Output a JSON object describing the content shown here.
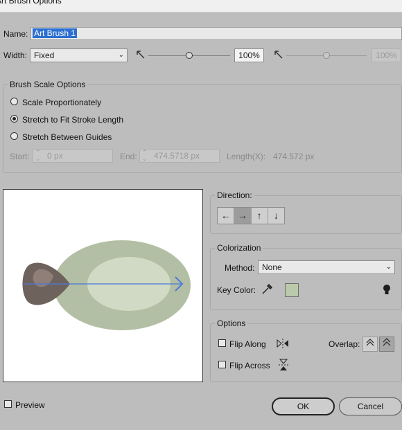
{
  "window": {
    "title": "Art Brush Options"
  },
  "name": {
    "label": "Name:",
    "value": "Art Brush 1"
  },
  "width": {
    "label": "Width:",
    "selected": "Fixed",
    "value_pct": "100%",
    "value2_pct": "100%",
    "slider_level": 0.5,
    "slider2_level": 0.5
  },
  "brush_scale": {
    "title": "Brush Scale Options",
    "options": [
      {
        "label": "Scale Proportionately",
        "selected": false
      },
      {
        "label": "Stretch to Fit Stroke Length",
        "selected": true
      },
      {
        "label": "Stretch Between Guides",
        "selected": false
      }
    ],
    "start_label": "Start:",
    "start_value": "0 px",
    "end_label": "End:",
    "end_value": "474.5718 px",
    "length_label": "Length(X):",
    "length_value": "474.572 px"
  },
  "direction": {
    "label": "Direction:",
    "buttons": [
      {
        "icon": "arrow-left-icon",
        "glyph": "←",
        "active": false
      },
      {
        "icon": "arrow-right-icon",
        "glyph": "→",
        "active": true
      },
      {
        "icon": "arrow-up-icon",
        "glyph": "↑",
        "active": false
      },
      {
        "icon": "arrow-down-icon",
        "glyph": "↓",
        "active": false
      }
    ]
  },
  "colorization": {
    "title": "Colorization",
    "method_label": "Method:",
    "method_value": "None",
    "key_color_label": "Key Color:",
    "key_color": "#b9c9aa"
  },
  "options": {
    "title": "Options",
    "flip_along_label": "Flip Along",
    "flip_across_label": "Flip Across",
    "overlap_label": "Overlap:"
  },
  "footer": {
    "preview_label": "Preview",
    "ok_label": "OK",
    "cancel_label": "Cancel"
  },
  "colors": {
    "dialog_bg": "#bdbdbd",
    "selection": "#2c6fd1",
    "direction_arrow": "#4a78d8",
    "leaf_dark": "#6e625d",
    "leaf_light": "#8f7f78",
    "ellipse_outer": "#b2bfa4",
    "ellipse_inner": "#d1dac4"
  }
}
